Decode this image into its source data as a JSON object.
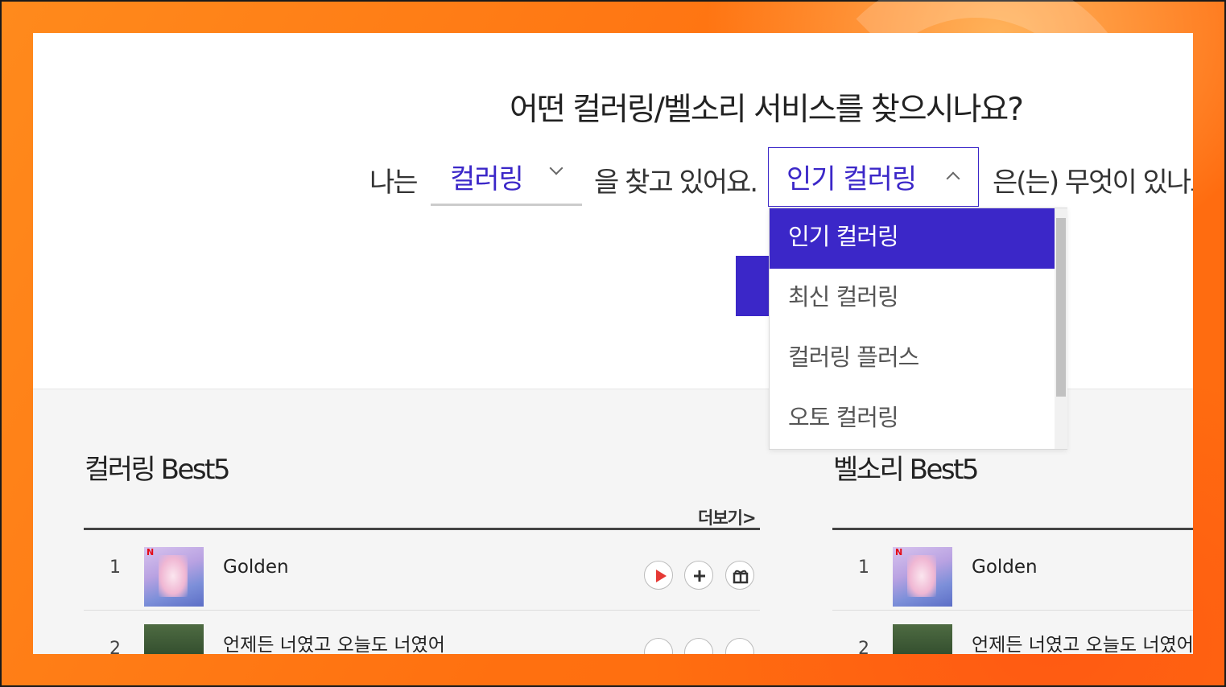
{
  "hero": {
    "title": "어떤 컬러링/벨소리 서비스를 찾으시나요?",
    "sentence": {
      "prefix": "나는",
      "service_select": {
        "selected": "컬러링"
      },
      "middle": "을 찾고 있어요.",
      "category_select": {
        "selected": "인기 컬러링"
      },
      "suffix": "은(는) 무엇이 있나요"
    }
  },
  "dropdown": {
    "options": [
      "인기 컬러링",
      "최신 컬러링",
      "컬러링 플러스",
      "오토 컬러링"
    ],
    "active_index": 0
  },
  "sections": {
    "coloring": {
      "title": "컬러링 Best5",
      "more_label": "더보기>",
      "rows": [
        {
          "rank": "1",
          "song": "Golden",
          "cover": "kpop-demon-hunters"
        },
        {
          "rank": "2",
          "song": "언제든 너였고 오늘도 너였어",
          "cover": "forest-album"
        }
      ]
    },
    "bell": {
      "title": "벨소리 Best5",
      "rows": [
        {
          "rank": "1",
          "song": "Golden",
          "cover": "kpop-demon-hunters"
        },
        {
          "rank": "2",
          "song": "언제든 너였고 오늘도 너였어",
          "cover": "forest-album"
        }
      ]
    }
  },
  "colors": {
    "accent": "#3b27c8",
    "frame_bg": "#ff7a14",
    "play_icon": "#e53935"
  }
}
